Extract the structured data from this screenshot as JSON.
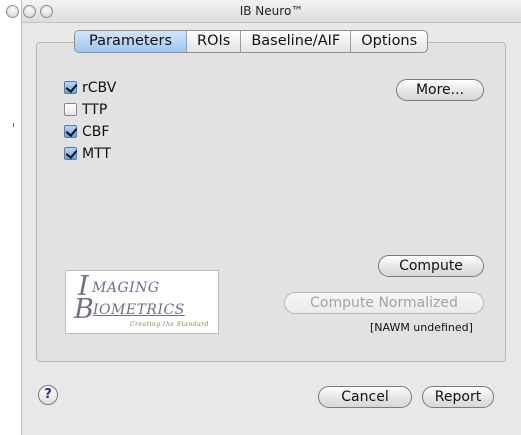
{
  "window": {
    "title": "IB Neuro™"
  },
  "tabs": [
    {
      "label": "Parameters",
      "active": true
    },
    {
      "label": "ROIs",
      "active": false
    },
    {
      "label": "Baseline/AIF",
      "active": false
    },
    {
      "label": "Options",
      "active": false
    }
  ],
  "parameters": [
    {
      "label": "rCBV",
      "checked": true
    },
    {
      "label": "TTP",
      "checked": false
    },
    {
      "label": "CBF",
      "checked": true
    },
    {
      "label": "MTT",
      "checked": true
    }
  ],
  "buttons": {
    "more": "More...",
    "compute": "Compute",
    "compute_normalized": "Compute Normalized",
    "cancel": "Cancel",
    "report": "Report",
    "help": "?"
  },
  "status": {
    "nawm": "[NAWM undefined]"
  },
  "logo": {
    "line1": "IMAGING",
    "line2": "BIOMETRICS",
    "tagline": "Creating the Standard"
  },
  "colors": {
    "active_tab": "#9fc6ee",
    "checkbox_checked": "#6aa3e0",
    "window_bg": "#e8e8e8",
    "logo_text": "#6d6f8a",
    "help_mark": "#4b1f8e"
  }
}
